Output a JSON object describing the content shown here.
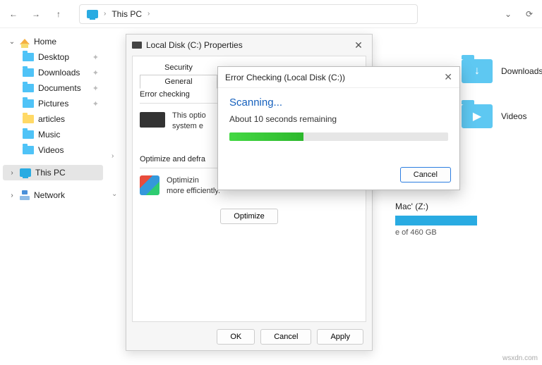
{
  "toolbar": {
    "address_label": "This PC"
  },
  "sidebar": {
    "home": "Home",
    "items": [
      "Desktop",
      "Downloads",
      "Documents",
      "Pictures",
      "articles",
      "Music",
      "Videos"
    ],
    "this_pc": "This PC",
    "network": "Network"
  },
  "tiles": {
    "downloads": "Downloads",
    "videos": "Videos"
  },
  "drive_frag": {
    "name": "Mac' (Z:)",
    "capacity": "e of 460 GB"
  },
  "properties": {
    "title": "Local Disk (C:) Properties",
    "tabs": {
      "security": "Security",
      "general": "General"
    },
    "error_checking": {
      "group": "Error checking",
      "line1": "This optio",
      "line2": "system e"
    },
    "optimize": {
      "group": "Optimize and defra",
      "line1": "Optimizin",
      "line2": "more efficiently.",
      "button": "Optimize"
    },
    "footer": {
      "ok": "OK",
      "cancel": "Cancel",
      "apply": "Apply"
    }
  },
  "error_dialog": {
    "title": "Error Checking (Local Disk (C:))",
    "heading": "Scanning...",
    "subtext": "About 10 seconds remaining",
    "progress_pct": 34,
    "cancel": "Cancel"
  },
  "watermark": "wsxdn.com"
}
